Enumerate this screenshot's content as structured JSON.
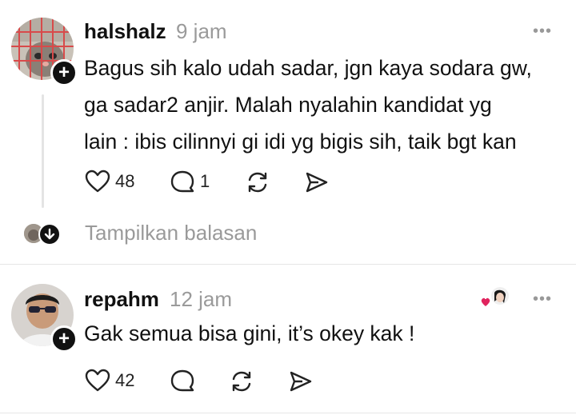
{
  "posts": [
    {
      "username": "halshalz",
      "time": "9 jam",
      "more": "•••",
      "text_lines": [
        "Bagus sih kalo udah sadar, jgn kaya sodara gw,",
        "ga sadar2 anjir. Malah nyalahin kandidat yg",
        "lain : ibis cilinnyi gi idi yg bigis sih, taik bgt kan"
      ],
      "likes": "48",
      "replies": "1",
      "show_replies_label": "Tampilkan balasan"
    },
    {
      "username": "repahm",
      "time": "12 jam",
      "more": "•••",
      "text_lines": [
        "Gak semua bisa gini, it’s okey kak !"
      ],
      "likes": "42"
    }
  ],
  "colors": {
    "text": "#111111",
    "muted": "#9a9a9a",
    "heart": "#e0245e"
  }
}
